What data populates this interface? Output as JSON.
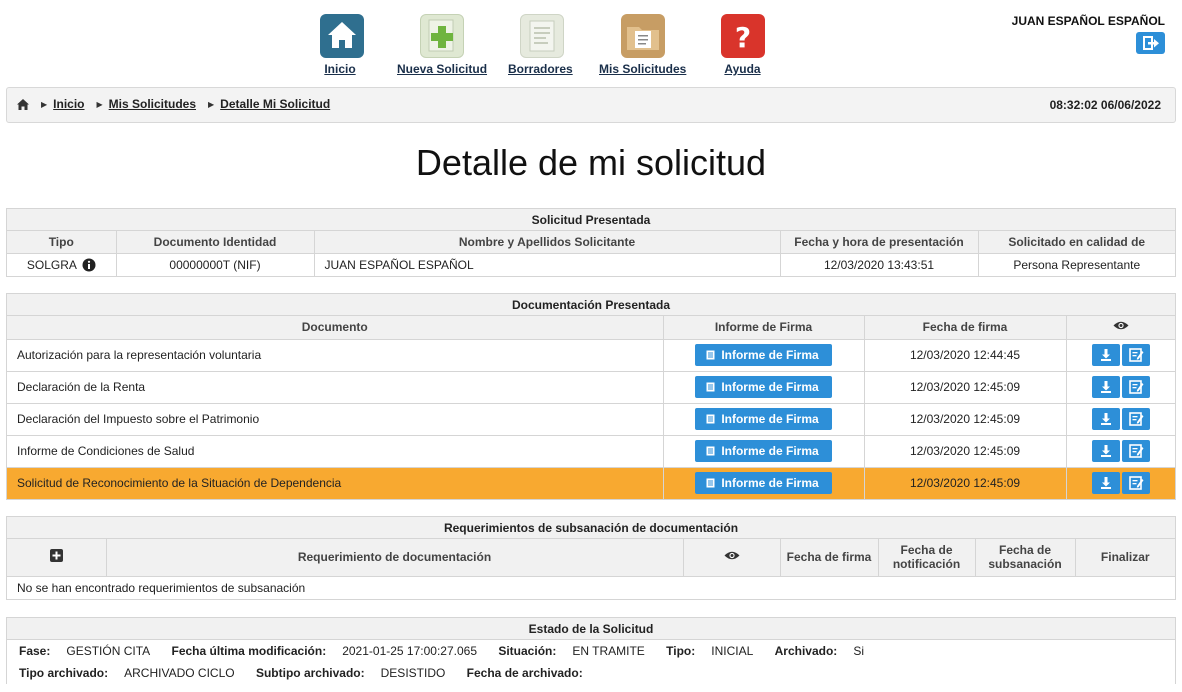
{
  "nav": {
    "items": [
      {
        "label": "Inicio",
        "icon": "home-icon",
        "color": "#2f6f8f"
      },
      {
        "label": "Nueva Solicitud",
        "icon": "new-request-icon",
        "color": "#d9e4c8"
      },
      {
        "label": "Borradores",
        "icon": "drafts-icon",
        "color": "#e2e6dc"
      },
      {
        "label": "Mis Solicitudes",
        "icon": "folder-icon",
        "color": "#c9a16a"
      },
      {
        "label": "Ayuda",
        "icon": "help-icon",
        "color": "#d9342b"
      }
    ]
  },
  "user": {
    "name": "JUAN ESPAÑOL ESPAÑOL",
    "logout_icon": "logout-icon"
  },
  "breadcrumb": {
    "items": [
      "Inicio",
      "Mis Solicitudes",
      "Detalle Mi Solicitud"
    ],
    "datetime": "08:32:02 06/06/2022"
  },
  "page": {
    "title": "Detalle de mi solicitud"
  },
  "solicitud": {
    "header": "Solicitud Presentada",
    "columns": [
      "Tipo",
      "Documento Identidad",
      "Nombre y Apellidos Solicitante",
      "Fecha y hora de presentación",
      "Solicitado en calidad de"
    ],
    "row": {
      "tipo": "SOLGRA",
      "documento": "00000000T (NIF)",
      "nombre": "JUAN ESPAÑOL ESPAÑOL",
      "fecha": "12/03/2020 13:43:51",
      "calidad": "Persona Representante"
    }
  },
  "documentacion": {
    "header": "Documentación Presentada",
    "columns": [
      "Documento",
      "Informe de Firma",
      "Fecha de firma"
    ],
    "button_label": "Informe de Firma",
    "rows": [
      {
        "documento": "Autorización para la representación voluntaria",
        "fecha": "12/03/2020 12:44:45"
      },
      {
        "documento": "Declaración de la Renta",
        "fecha": "12/03/2020 12:45:09"
      },
      {
        "documento": "Declaración del Impuesto sobre el Patrimonio",
        "fecha": "12/03/2020 12:45:09"
      },
      {
        "documento": "Informe de Condiciones de Salud",
        "fecha": "12/03/2020 12:45:09"
      },
      {
        "documento": "Solicitud de Reconocimiento de la Situación de Dependencia",
        "fecha": "12/03/2020 12:45:09"
      }
    ],
    "highlight_color": "#f8a930"
  },
  "requerimientos": {
    "header": "Requerimientos de subsanación de documentación",
    "columns": [
      "Requerimiento de documentación",
      "Fecha de firma",
      "Fecha de notificación",
      "Fecha de subsanación",
      "Finalizar"
    ],
    "empty_message": "No se han encontrado requerimientos de subsanación"
  },
  "estado": {
    "header": "Estado de la Solicitud",
    "fase_label": "Fase:",
    "fase": "GESTIÓN CITA",
    "modificacion_label": "Fecha última modificación:",
    "modificacion": "2021-01-25 17:00:27.065",
    "situacion_label": "Situación:",
    "situacion": "EN TRAMITE",
    "tipo_label": "Tipo:",
    "tipo": "INICIAL",
    "archivado_label": "Archivado:",
    "archivado": "Si",
    "tipo_archivado_label": "Tipo archivado:",
    "tipo_archivado": "ARCHIVADO CICLO",
    "subtipo_label": "Subtipo archivado:",
    "subtipo": "DESISTIDO",
    "fecha_archivado_label": "Fecha de archivado:",
    "fecha_archivado": ""
  },
  "colors": {
    "accent": "#2d8fd8",
    "header_bg": "#f1f1f1"
  }
}
